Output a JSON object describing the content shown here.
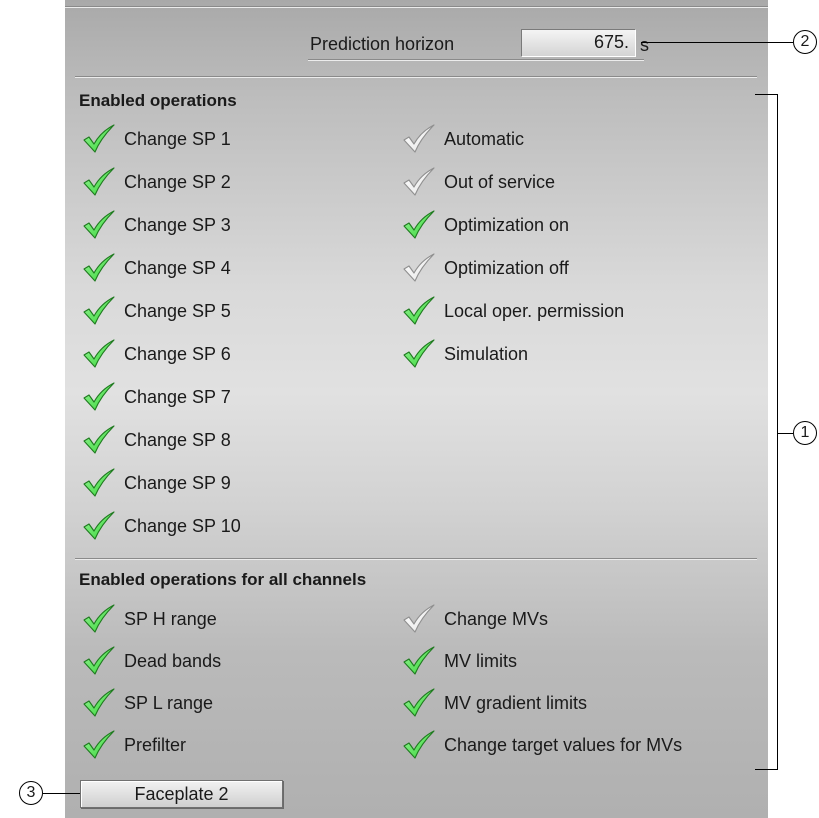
{
  "prediction_horizon": {
    "label": "Prediction horizon",
    "value": "675.",
    "unit": "s"
  },
  "enabled_operations": {
    "title": "Enabled operations",
    "left_items": [
      {
        "label": "Change SP 1",
        "enabled": true
      },
      {
        "label": "Change SP 2",
        "enabled": true
      },
      {
        "label": "Change SP 3",
        "enabled": true
      },
      {
        "label": "Change SP 4",
        "enabled": true
      },
      {
        "label": "Change SP 5",
        "enabled": true
      },
      {
        "label": "Change SP 6",
        "enabled": true
      },
      {
        "label": "Change SP 7",
        "enabled": true
      },
      {
        "label": "Change SP 8",
        "enabled": true
      },
      {
        "label": "Change SP 9",
        "enabled": true
      },
      {
        "label": "Change SP 10",
        "enabled": true
      }
    ],
    "right_items": [
      {
        "label": "Automatic",
        "enabled": false
      },
      {
        "label": "Out of service",
        "enabled": false
      },
      {
        "label": "Optimization on",
        "enabled": true
      },
      {
        "label": "Optimization off",
        "enabled": false
      },
      {
        "label": "Local oper. permission",
        "enabled": true
      },
      {
        "label": "Simulation",
        "enabled": true
      }
    ]
  },
  "all_channels": {
    "title": "Enabled operations for all channels",
    "left_items": [
      {
        "label": "SP H range",
        "enabled": true
      },
      {
        "label": "Dead bands",
        "enabled": true
      },
      {
        "label": "SP L range",
        "enabled": true
      },
      {
        "label": "Prefilter",
        "enabled": true
      }
    ],
    "right_items": [
      {
        "label": "Change MVs",
        "enabled": false
      },
      {
        "label": "MV limits",
        "enabled": true
      },
      {
        "label": "MV gradient limits",
        "enabled": true
      },
      {
        "label": "Change target values for MVs",
        "enabled": true
      }
    ]
  },
  "faceplate_button": {
    "label": "Faceplate 2"
  },
  "callouts": {
    "c1": "1",
    "c2": "2",
    "c3": "3"
  },
  "icons": {
    "enabled": "green-check-icon",
    "disabled": "grey-check-icon"
  },
  "colors": {
    "check_green": "#2fd42f",
    "check_grey": "#e6e6e6"
  }
}
